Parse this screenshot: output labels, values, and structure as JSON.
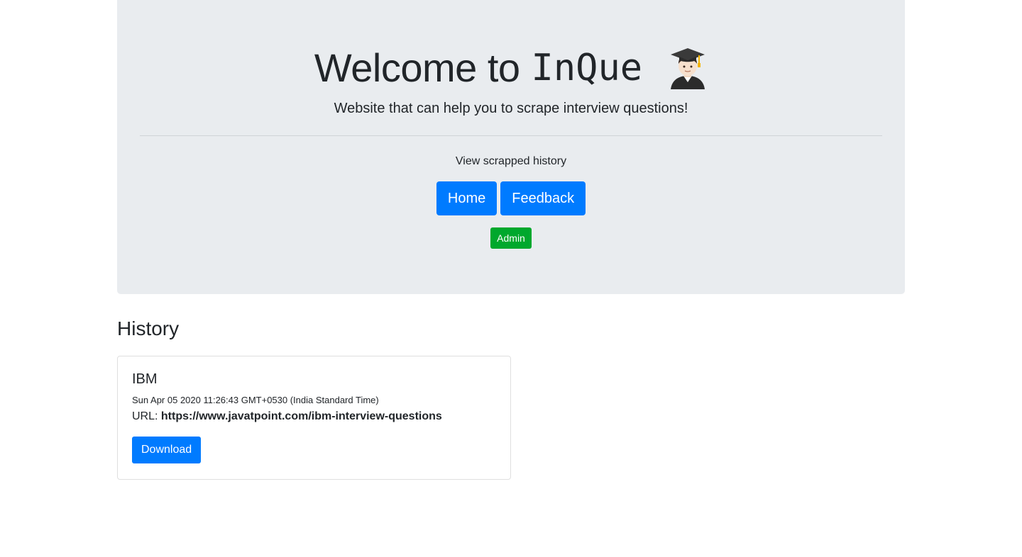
{
  "hero": {
    "title_prefix": "Welcome to",
    "brand": "InQue",
    "icon": "student-graduation-cap-icon",
    "subtitle": "Website that can help you to scrape interview questions!",
    "history_link": "View scrapped history"
  },
  "nav": {
    "home_label": "Home",
    "feedback_label": "Feedback",
    "admin_label": "Admin"
  },
  "history": {
    "heading": "History",
    "items": [
      {
        "company": "IBM",
        "date": "Sun Apr 05 2020 11:26:43 GMT+0530 (India Standard Time)",
        "url_label": "URL:",
        "url": "https://www.javatpoint.com/ibm-interview-questions",
        "download_label": "Download"
      }
    ]
  },
  "colors": {
    "primary": "#007bff",
    "success": "#00a82d",
    "jumbotron_bg": "#e9ecef"
  }
}
